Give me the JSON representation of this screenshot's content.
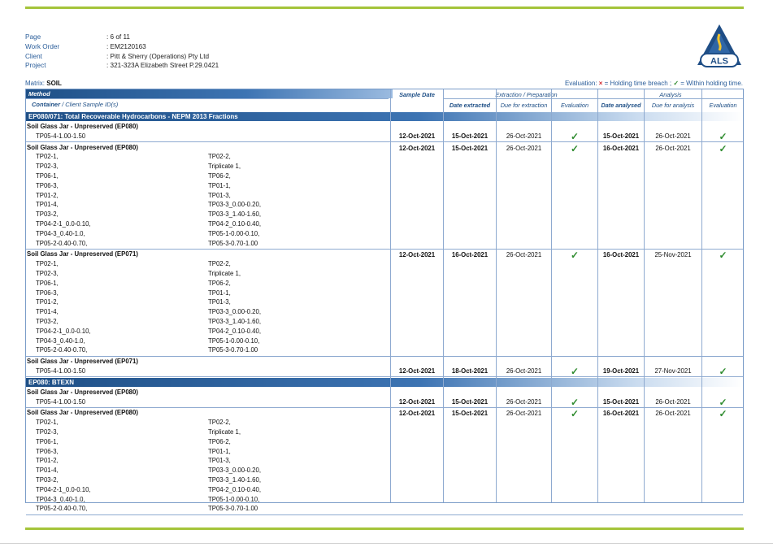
{
  "header": {
    "fields": [
      {
        "label": "Page",
        "value": ": 6 of 11"
      },
      {
        "label": "Work Order",
        "value": ": EM2120163"
      },
      {
        "label": "Client",
        "value": ": Pitt & Sherry (Operations) Pty Ltd"
      },
      {
        "label": "Project",
        "value": ": 321-323A Elizabeth Street P.29.0421"
      }
    ],
    "logo_text": "ALS"
  },
  "matrix": {
    "label": "Matrix: ",
    "value": "SOIL"
  },
  "legend": {
    "prefix": "Evaluation: ",
    "breach_symbol": "×",
    "breach_text": " = Holding time breach ; ",
    "within_symbol": "✓",
    "within_text": " = Within holding time."
  },
  "table_headers": {
    "method": "Method",
    "container": "Container",
    "sample_ids": " / Client Sample ID(s)",
    "sample_date": "Sample Date",
    "extraction": "Extraction / Preparation",
    "analysis": "Analysis",
    "date_extracted": "Date extracted",
    "due_extraction": "Due for extraction",
    "evaluation": "Evaluation",
    "date_analysed": "Date analysed",
    "due_analysis": "Due for analysis"
  },
  "colors": {
    "accent_green": "#a4c43a",
    "header_blue": "#1e4f86",
    "tick_green": "#2e8b2e",
    "breach_red": "#d2282e"
  },
  "sections": [
    {
      "title": "EP080/071: Total Recoverable Hydrocarbons - NEPM 2013 Fractions",
      "groups": [
        {
          "title": "Soil Glass Jar - Unpreserved (EP080)",
          "samples": [
            [
              "TP05-4-1.00-1.50",
              ""
            ]
          ],
          "sample_date": "12-Oct-2021",
          "date_extracted": "15-Oct-2021",
          "due_extraction": "26-Oct-2021",
          "eval1": "✓",
          "date_analysed": "15-Oct-2021",
          "due_analysis": "26-Oct-2021",
          "eval2": "✓"
        },
        {
          "title": "Soil Glass Jar - Unpreserved (EP080)",
          "samples": [
            [
              "TP02-1,",
              "TP02-2,"
            ],
            [
              "TP02-3,",
              "Triplicate 1,"
            ],
            [
              "TP06-1,",
              "TP06-2,"
            ],
            [
              "TP06-3,",
              "TP01-1,"
            ],
            [
              "TP01-2,",
              "TP01-3,"
            ],
            [
              "TP01-4,",
              "TP03-3_0.00-0.20,"
            ],
            [
              "TP03-2,",
              "TP03-3_1.40-1.60,"
            ],
            [
              "TP04-2-1_0.0-0.10,",
              "TP04-2_0.10-0.40,"
            ],
            [
              "TP04-3_0.40-1.0,",
              "TP05-1-0.00-0.10,"
            ],
            [
              "TP05-2-0.40-0.70,",
              "TP05-3-0.70-1.00"
            ]
          ],
          "sample_date": "12-Oct-2021",
          "date_extracted": "15-Oct-2021",
          "due_extraction": "26-Oct-2021",
          "eval1": "✓",
          "date_analysed": "16-Oct-2021",
          "due_analysis": "26-Oct-2021",
          "eval2": "✓"
        },
        {
          "title": "Soil Glass Jar - Unpreserved (EP071)",
          "samples": [
            [
              "TP02-1,",
              "TP02-2,"
            ],
            [
              "TP02-3,",
              "Triplicate 1,"
            ],
            [
              "TP06-1,",
              "TP06-2,"
            ],
            [
              "TP06-3,",
              "TP01-1,"
            ],
            [
              "TP01-2,",
              "TP01-3,"
            ],
            [
              "TP01-4,",
              "TP03-3_0.00-0.20,"
            ],
            [
              "TP03-2,",
              "TP03-3_1.40-1.60,"
            ],
            [
              "TP04-2-1_0.0-0.10,",
              "TP04-2_0.10-0.40,"
            ],
            [
              "TP04-3_0.40-1.0,",
              "TP05-1-0.00-0.10,"
            ],
            [
              "TP05-2-0.40-0.70,",
              "TP05-3-0.70-1.00"
            ]
          ],
          "sample_date": "12-Oct-2021",
          "date_extracted": "16-Oct-2021",
          "due_extraction": "26-Oct-2021",
          "eval1": "✓",
          "date_analysed": "16-Oct-2021",
          "due_analysis": "25-Nov-2021",
          "eval2": "✓"
        },
        {
          "title": "Soil Glass Jar - Unpreserved (EP071)",
          "samples": [
            [
              "TP05-4-1.00-1.50",
              ""
            ]
          ],
          "sample_date": "12-Oct-2021",
          "date_extracted": "18-Oct-2021",
          "due_extraction": "26-Oct-2021",
          "eval1": "✓",
          "date_analysed": "19-Oct-2021",
          "due_analysis": "27-Nov-2021",
          "eval2": "✓"
        }
      ]
    },
    {
      "title": "EP080: BTEXN",
      "groups": [
        {
          "title": "Soil Glass Jar - Unpreserved (EP080)",
          "samples": [
            [
              "TP05-4-1.00-1.50",
              ""
            ]
          ],
          "sample_date": "12-Oct-2021",
          "date_extracted": "15-Oct-2021",
          "due_extraction": "26-Oct-2021",
          "eval1": "✓",
          "date_analysed": "15-Oct-2021",
          "due_analysis": "26-Oct-2021",
          "eval2": "✓"
        },
        {
          "title": "Soil Glass Jar - Unpreserved (EP080)",
          "samples": [
            [
              "TP02-1,",
              "TP02-2,"
            ],
            [
              "TP02-3,",
              "Triplicate 1,"
            ],
            [
              "TP06-1,",
              "TP06-2,"
            ],
            [
              "TP06-3,",
              "TP01-1,"
            ],
            [
              "TP01-2,",
              "TP01-3,"
            ],
            [
              "TP01-4,",
              "TP03-3_0.00-0.20,"
            ],
            [
              "TP03-2,",
              "TP03-3_1.40-1.60,"
            ],
            [
              "TP04-2-1_0.0-0.10,",
              "TP04-2_0.10-0.40,"
            ],
            [
              "TP04-3_0.40-1.0,",
              "TP05-1-0.00-0.10,"
            ],
            [
              "TP05-2-0.40-0.70,",
              "TP05-3-0.70-1.00"
            ]
          ],
          "sample_date": "12-Oct-2021",
          "date_extracted": "15-Oct-2021",
          "due_extraction": "26-Oct-2021",
          "eval1": "✓",
          "date_analysed": "16-Oct-2021",
          "due_analysis": "26-Oct-2021",
          "eval2": "✓"
        }
      ]
    }
  ]
}
